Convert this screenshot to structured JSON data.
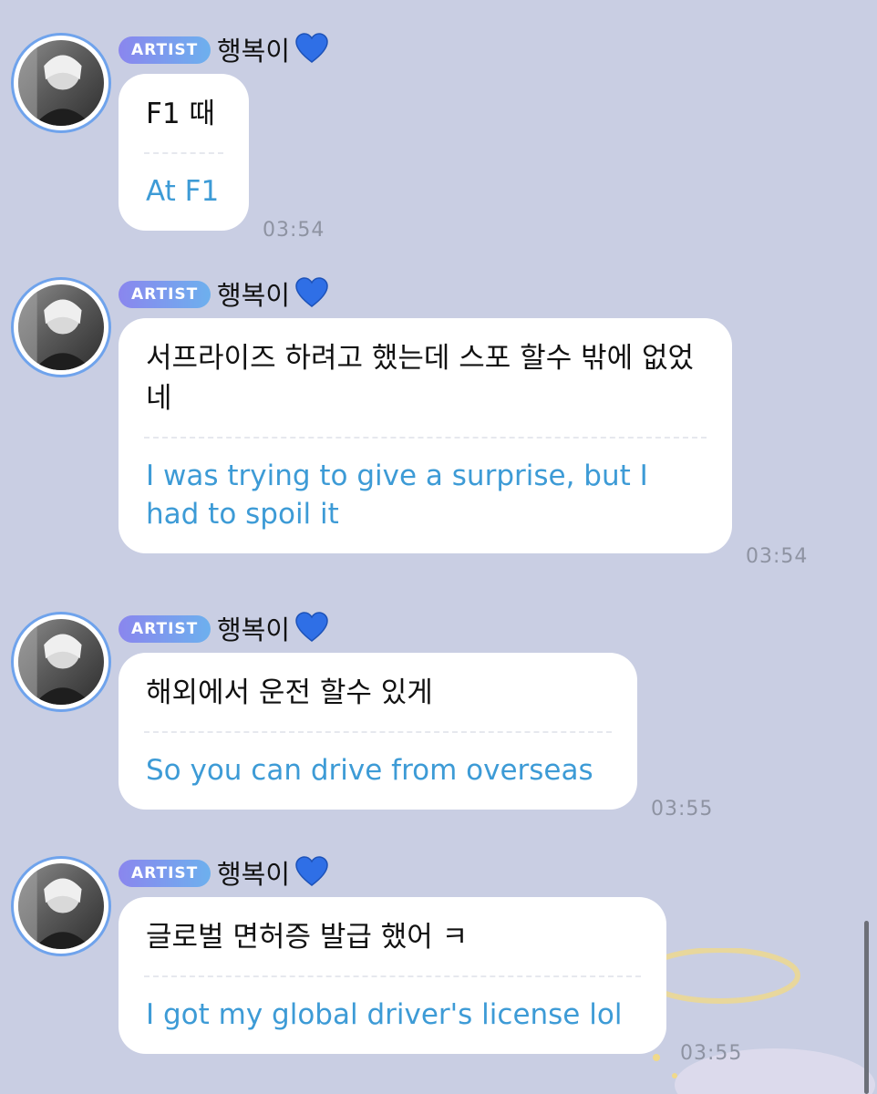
{
  "chat": {
    "messages": [
      {
        "badge": "ARTIST",
        "sender": "행복이",
        "korean": "F1 때",
        "english": "At F1",
        "time": "03:54"
      },
      {
        "badge": "ARTIST",
        "sender": "행복이",
        "korean": "서프라이즈 하려고 했는데 스포 할수 밖에 없었네",
        "english": "I was trying to give a surprise, but I had to spoil it",
        "time": "03:54"
      },
      {
        "badge": "ARTIST",
        "sender": "행복이",
        "korean": "해외에서 운전 할수 있게",
        "english": "So you can drive from overseas",
        "time": "03:55"
      },
      {
        "badge": "ARTIST",
        "sender": "행복이",
        "korean": "글로벌 면허증 발급 했어 ㅋ",
        "english": "I got my global driver's license lol",
        "time": "03:55"
      }
    ]
  },
  "icons": {
    "heart": "blue-heart-icon",
    "avatar": "profile-photo"
  },
  "colors": {
    "background": "#c9cee3",
    "bubble": "#ffffff",
    "translation_text": "#3d9bd6",
    "badge_start": "#8a86ee",
    "badge_end": "#6db0ee",
    "heart": "#2f6fe6",
    "avatar_ring": "#6fa3ec"
  }
}
